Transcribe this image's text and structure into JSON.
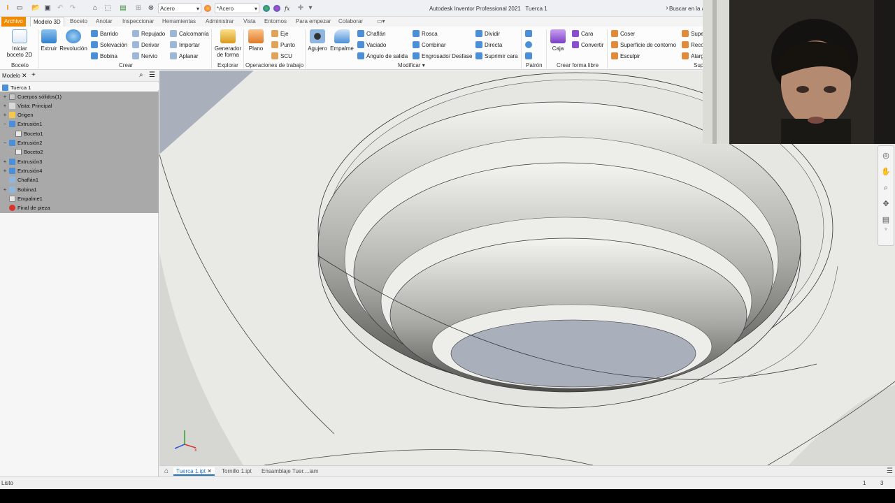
{
  "window": {
    "title": "Autodesk Inventor Professional 2021",
    "document": "Tuerca 1",
    "search_placeholder": "Buscar en la a"
  },
  "qat": {
    "material": "Acero",
    "appearance": "*Acero",
    "fx": "fx"
  },
  "tabs": [
    "Archivo",
    "Modelo 3D",
    "Boceto",
    "Anotar",
    "Inspeccionar",
    "Herramientas",
    "Administrar",
    "Vista",
    "Entornos",
    "Para empezar",
    "Colaborar"
  ],
  "ribbon": {
    "boceto": {
      "start": "Iniciar\nboceto 2D",
      "group": "Boceto"
    },
    "crear": {
      "extruir": "Extruir",
      "revolucion": "Revolución",
      "barrido": "Barrido",
      "solevacion": "Solevación",
      "bobina": "Bobina",
      "repujado": "Repujado",
      "derivar": "Derivar",
      "nervio": "Nervio",
      "calcomania": "Calcomanía",
      "importar": "Importar",
      "aplanar": "Aplanar",
      "group": "Crear"
    },
    "explorar": {
      "generador": "Generador\nde forma",
      "group": "Explorar"
    },
    "trabajo": {
      "plano": "Plano",
      "eje": "Eje",
      "punto": "Punto",
      "scu": "SCU",
      "group": "Operaciones de trabajo"
    },
    "modificar": {
      "agujero": "Agujero",
      "empalme": "Empalme",
      "chaflan": "Chaflán",
      "vaciado": "Vaciado",
      "angulo": "Ángulo de salida",
      "rosca": "Rosca",
      "combinar": "Combinar",
      "engrosado": "Engrosado/ Desfase",
      "dividir": "Dividir",
      "directa": "Directa",
      "suprimir": "Suprimir cara",
      "group": "Modificar"
    },
    "patron": {
      "group": "Patrón"
    },
    "libre": {
      "caja": "Caja",
      "cara": "Cara",
      "convertir": "Convertir",
      "group": "Crear forma libre"
    },
    "superficie": {
      "coser": "Coser",
      "contorno": "Superficie de contorno",
      "esculpir": "Esculpir",
      "supe": "Supe",
      "reco": "Reco",
      "alarg": "Alarg",
      "group": "Sup"
    }
  },
  "browser": {
    "tab": "Modelo",
    "root": "Tuerca 1",
    "items": [
      "Cuerpos sólidos(1)",
      "Vista: Principal",
      "Origen",
      "Extrusión1",
      "Boceto1",
      "Extrusión2",
      "Boceto2",
      "Extrusión3",
      "Extrusión4",
      "Chaflán1",
      "Bobina1",
      "Empalme1",
      "Final de pieza"
    ]
  },
  "doc_tabs": [
    "Tuerca 1.ipt",
    "Tornillo 1.ipt",
    "Ensamblaje Tuer....iam"
  ],
  "status": {
    "text": "Listo",
    "n1": "1",
    "n2": "3"
  },
  "colors": {
    "accent": "#f08a00",
    "tree_bg": "#a9a9a9",
    "model": "#e6e6e2",
    "hole_floor": "#a9b0bc"
  }
}
